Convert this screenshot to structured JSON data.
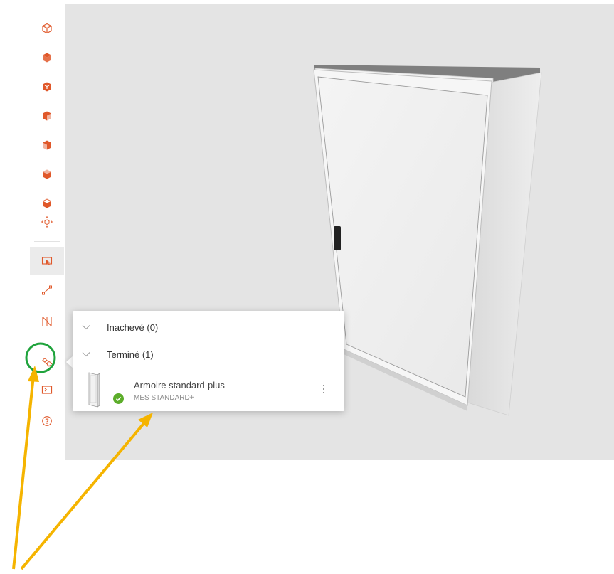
{
  "toolbar": {
    "items": [
      {
        "icon": "cube-outline-icon"
      },
      {
        "icon": "cube-top-view-icon"
      },
      {
        "icon": "cube-iso-view-icon"
      },
      {
        "icon": "cube-front-view-icon"
      },
      {
        "icon": "cube-left-view-icon"
      },
      {
        "icon": "cube-right-view-icon"
      },
      {
        "icon": "cube-back-view-icon"
      },
      {
        "icon": "orbit-move-icon"
      },
      {
        "icon": "select-icon",
        "active": true
      },
      {
        "icon": "measure-icon"
      },
      {
        "icon": "section-icon"
      },
      {
        "icon": "gears-icon",
        "highlighted": true
      },
      {
        "icon": "render-icon"
      },
      {
        "icon": "help-icon"
      }
    ],
    "accent": "#e0582a"
  },
  "panel": {
    "groups": [
      {
        "label": "Inachevé (0)",
        "expanded": false
      },
      {
        "label": "Terminé (1)",
        "expanded": true
      }
    ],
    "item": {
      "title": "Armoire standard-plus",
      "subtitle": "MES STANDARD+",
      "status": "complete",
      "status_color": "#5cad2a"
    }
  },
  "annotations": {
    "circle_color": "#1fa33c",
    "arrow_color": "#f5b400"
  }
}
